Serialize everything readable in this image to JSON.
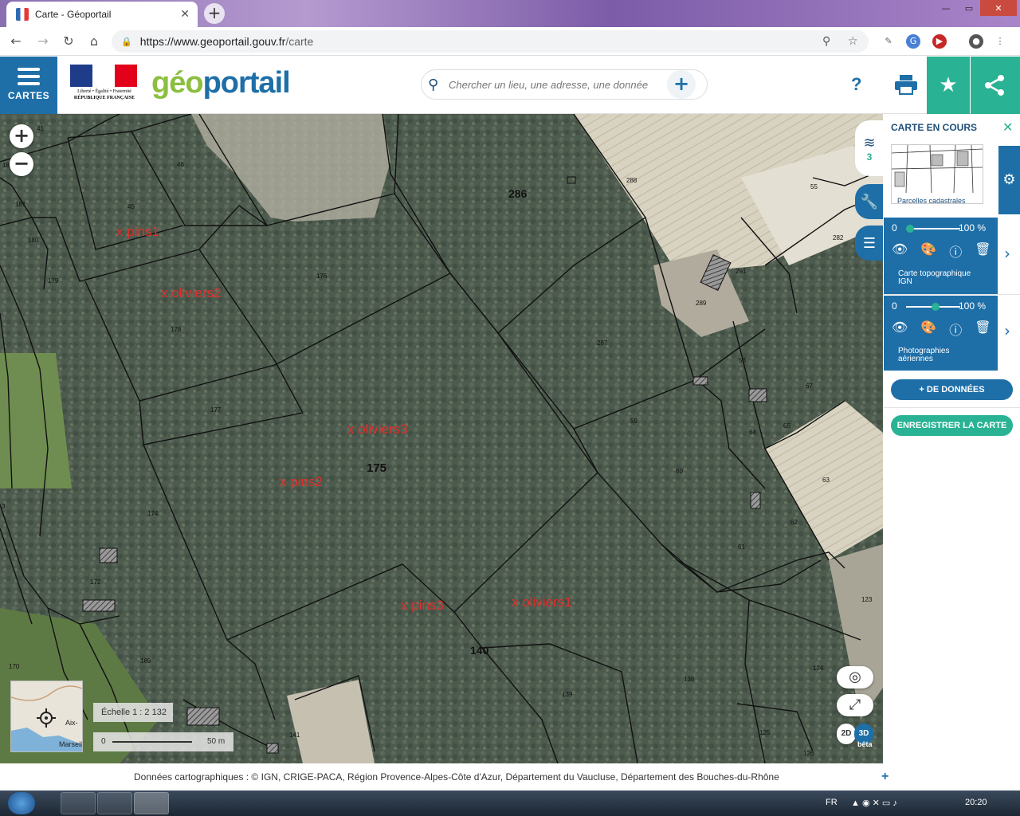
{
  "browser": {
    "tab_title": "Carte - Géoportail",
    "tab_close": "✕",
    "new_tab": "+",
    "url_host": "https://www.geoportail.gouv.fr",
    "url_path": "/carte",
    "back": "←",
    "forward": "→",
    "reload": "↻",
    "home": "⌂",
    "window_min": "—",
    "window_max": "▭",
    "window_close": "✕"
  },
  "header": {
    "cartes_label": "CARTES",
    "logo_part1": "géo",
    "logo_part2": "portail",
    "rf_line1": "Liberté • Égalité • Fraternité",
    "rf_line2": "RÉPUBLIQUE FRANÇAISE",
    "search_placeholder": "Chercher un lieu, une adresse, une donnée",
    "search_plus": "+",
    "help": "?"
  },
  "map": {
    "zoom_in": "+",
    "zoom_out": "−",
    "scale_text": "Échelle 1 : 2 132",
    "scale_start": "0",
    "scale_end": "50 m",
    "minimap_label1": "Aix-",
    "minimap_label2": "Marseil",
    "mode_2d": "2D",
    "mode_3d": "3D",
    "mode_beta": "bêta",
    "parcels": [
      "41",
      "182",
      "46",
      "181",
      "45",
      "180",
      "179",
      "176",
      "178",
      "177",
      "175",
      "174",
      "172",
      "170",
      "169",
      "141",
      "140",
      "139",
      "138",
      "286",
      "288",
      "55",
      "282",
      "291",
      "289",
      "287",
      "58",
      "67",
      "65",
      "64",
      "59",
      "60",
      "63",
      "62",
      "61",
      "123",
      "124",
      "125",
      "126",
      "3"
    ],
    "annotations": [
      "x pins1",
      "x oliviers2",
      "x oliviers3",
      "x pins2",
      "x pins3",
      "x oliviers1"
    ]
  },
  "attribution": {
    "text": "Données cartographiques : ©  IGN,  CRIGE-PACA,  Région Provence-Alpes-Côte d'Azur,  Département du Vaucluse,  Département des Bouches-du-Rhône",
    "plus": "+"
  },
  "panel": {
    "layers_count": "3",
    "title": "CARTE EN COURS",
    "close": "✕",
    "thumb_label": "Parcelles cadastrales",
    "layers": [
      {
        "name_line1": "Carte topographique",
        "name_line2": "IGN",
        "opacity_min": "0",
        "opacity_value": "100 %",
        "knob_fraction": 0.0
      },
      {
        "name_line1": "Photographies",
        "name_line2": "aériennes",
        "opacity_min": "0",
        "opacity_value": "100 %",
        "knob_fraction": 0.52
      }
    ],
    "add_data": "+ DE DONNÉES",
    "save_map": "ENREGISTRER LA CARTE"
  },
  "taskbar": {
    "lang": "FR",
    "clock": "20:20"
  },
  "colors": {
    "blue": "#1e6fa8",
    "teal": "#29b294",
    "annotation_red": "#e0302a"
  }
}
